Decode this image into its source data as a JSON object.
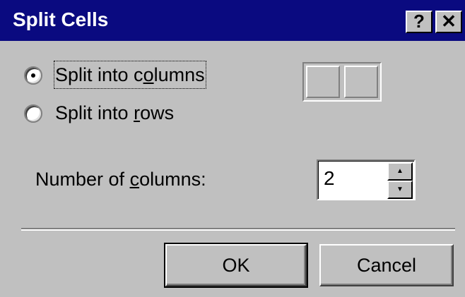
{
  "window": {
    "title": "Split Cells",
    "help_button": "?",
    "close_button": "✕",
    "title_bar_color": "#0a0a80",
    "face_color": "#c0c0c0"
  },
  "split_options": {
    "selected": "columns",
    "columns": {
      "before": "Split into c",
      "mnemonic": "o",
      "after": "lumns"
    },
    "rows": {
      "before": "Split into ",
      "mnemonic": "r",
      "after": "ows"
    }
  },
  "preview": {
    "cells": 2
  },
  "number_field": {
    "label_before": "Number of ",
    "label_mnemonic": "c",
    "label_after": "olumns:",
    "value": "2"
  },
  "buttons": {
    "ok": "OK",
    "cancel": "Cancel"
  },
  "icons": {
    "spin_up": "triangle-up-icon",
    "spin_down": "triangle-down-icon"
  }
}
